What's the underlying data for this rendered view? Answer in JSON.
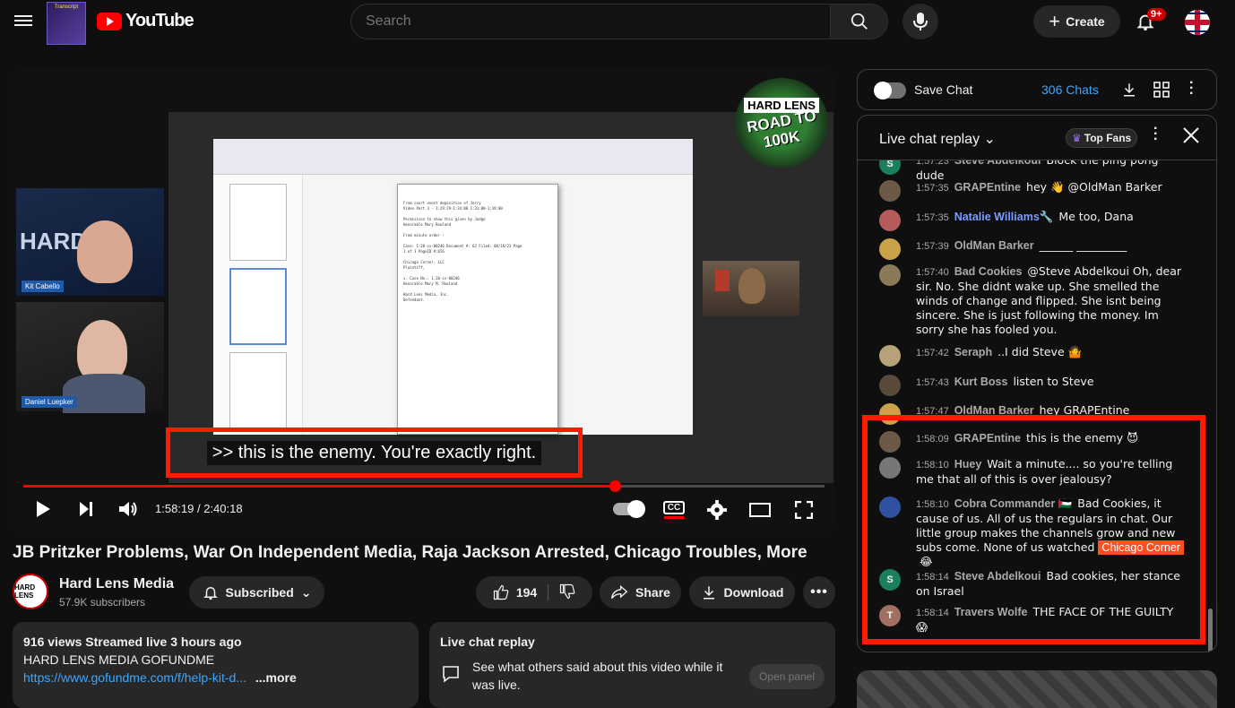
{
  "header": {
    "logo_text": "YouTube",
    "extension_logo": "Transcript",
    "search_placeholder": "Search",
    "create_label": "Create",
    "notif_badge": "9+"
  },
  "video": {
    "caption": ">> this is the enemy. You're exactly right.",
    "time": "1:58:19 / 2:40:18",
    "progress_fraction": 0.738,
    "cam1_label": "Kit Cabello",
    "cam2_label": "Daniel Luepker",
    "overlay_logo_line1": "HARD LENS",
    "overlay_logo_line2": "ROAD TO",
    "overlay_logo_line3": "100K",
    "cc_label": "CC",
    "notepad_text": "From court event deposition of Jerry\nVideo Part 3 - 1:29:29-1:34:00 1:31:00-1:19:00\n\nPermission to show this given by Judge\nHonorable Mary Rowland\n\nFrom minute order -\n\nCase: 1:20-cv-00246 Document #: 62 Filed: 08/16/23 Page\n1 of 3 PageID #:656\n\nChicago Corner, LLC\nPlaintiff,\n\nv. Case No.: 1:20-cv-00246\nHonorable Mary M. Rowland\n\nHard Lens Media, Inc.\nDefendant."
  },
  "info": {
    "title": "JB Pritzker Problems, War On Independent Media, Raja Jackson Arrested, Chicago Troubles, More",
    "channel_name": "Hard Lens Media",
    "subscribers": "57.9K subscribers",
    "channel_avatar_text": "HARD LENS",
    "subscribed_label": "Subscribed",
    "likes": "194",
    "share_label": "Share",
    "download_label": "Download",
    "desc_meta": "916 views  Streamed live 3 hours ago",
    "desc_line": "HARD LENS MEDIA GOFUNDME",
    "desc_link": "https://www.gofundme.com/f/help-kit-d...",
    "desc_more": "...more",
    "lcr_title": "Live chat replay",
    "lcr_text": "See what others said about this video while it was live.",
    "lcr_button": "Open panel"
  },
  "chat": {
    "save_label": "Save Chat",
    "count_label": "306 Chats",
    "header_title": "Live chat replay",
    "top_fans": "Top Fans",
    "messages": [
      {
        "ts": "1:57:23",
        "author": "Steve Abdelkoui",
        "text": "Block the ping pong dude",
        "avatar_color": "#1a7f5a",
        "avatar_letter": "S"
      },
      {
        "ts": "1:57:35",
        "author": "GRAPEntine",
        "text": "hey 👋 @OldMan Barker",
        "avatar_color": "#6d5a46",
        "avatar_letter": ""
      },
      {
        "ts": "1:57:35",
        "author": "Natalie Williams🔧",
        "text": "Me too, Dana",
        "avatar_color": "#b55b5b",
        "avatar_letter": ""
      },
      {
        "ts": "1:57:39",
        "author": "OldMan Barker",
        "text": "______ _________",
        "avatar_color": "#c9a24a",
        "avatar_letter": ""
      },
      {
        "ts": "1:57:40",
        "author": "Bad Cookies",
        "text": "@Steve Abdelkoui Oh, dear sir. No. She didnt wake up. She smelled the winds of change and flipped. She isnt being sincere. She is just following the money. Im sorry she has fooled you.",
        "avatar_color": "#8a7a5a",
        "avatar_letter": ""
      },
      {
        "ts": "1:57:42",
        "author": "Seraph",
        "text": "..I did Steve 🤷",
        "avatar_color": "#b8a27a",
        "avatar_letter": ""
      },
      {
        "ts": "1:57:43",
        "author": "Kurt Boss",
        "text": "listen to Steve",
        "avatar_color": "#5a4a3a",
        "avatar_letter": ""
      },
      {
        "ts": "1:57:47",
        "author": "OldMan Barker",
        "text": "hey GRAPEntine",
        "avatar_color": "#c9a24a",
        "avatar_letter": ""
      },
      {
        "ts": "1:58:09",
        "author": "GRAPEntine",
        "text": "this is the enemy 😈",
        "avatar_color": "#6d5a46",
        "avatar_letter": ""
      },
      {
        "ts": "1:58:10",
        "author": "Huey",
        "text": "Wait a minute.... so you're telling me that all of this is over jealousy?",
        "avatar_color": "#777",
        "avatar_letter": ""
      },
      {
        "ts": "1:58:10",
        "author": "Cobra Commander 🇵🇸",
        "text": "Bad Cookies, it cause of us. All of us the regulars in chat. Our little group makes the channels grow and new subs come. None of us watched",
        "chip": "Chicago Corner",
        "after_chip": "😂",
        "avatar_color": "#3050a0",
        "avatar_letter": ""
      },
      {
        "ts": "1:58:14",
        "author": "Steve Abdelkoui",
        "text": "Bad cookies, her stance on Israel",
        "avatar_color": "#1a7f5a",
        "avatar_letter": "S"
      },
      {
        "ts": "1:58:14",
        "author": "Travers Wolfe",
        "text": "THE FACE OF THE GUILTY 😱",
        "avatar_color": "#a07060",
        "avatar_letter": "T"
      }
    ]
  }
}
